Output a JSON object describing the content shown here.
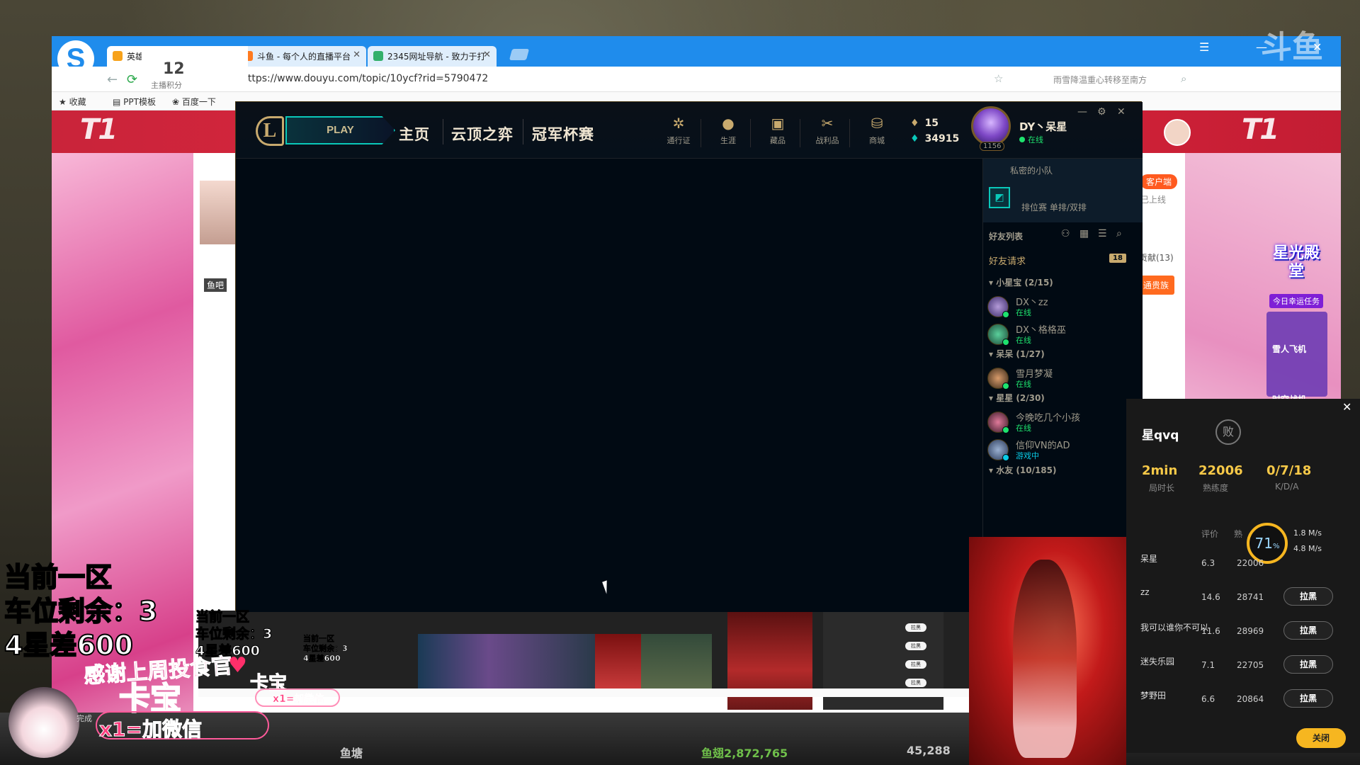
{
  "browser": {
    "tabs": [
      {
        "title": "英雄联盟自动化晋级周榜"
      },
      {
        "title": "斗鱼 - 每个人的直播平台"
      },
      {
        "title": "2345网址导航 - 致力于打"
      }
    ],
    "url": "https://www.douyu.com/topic/10ycf?rid=5790472",
    "search_placeholder": "雨雪降温重心转移至南方",
    "bookmarks": [
      "收藏",
      "PPT模板",
      "百度一下"
    ]
  },
  "page": {
    "score_value": "12",
    "score_label": "主播积分",
    "anchor_label": "鱼吧",
    "client_badge": "客户端",
    "online_text": "已上线",
    "box_count": "贡献(13)",
    "right_button": "通贵族",
    "starlight_title": "星光殿堂",
    "starlight_tag": "今日幸运任务",
    "gifts": [
      "雪人飞机",
      "时空战机"
    ],
    "watermark": "斗鱼"
  },
  "lol": {
    "play_label": "PLAY",
    "nav": [
      "主页",
      "云顶之弈",
      "冠军杯赛"
    ],
    "icon_buttons": [
      {
        "icon": "pass-icon",
        "label": "通行证"
      },
      {
        "icon": "profile-icon",
        "label": "生涯"
      },
      {
        "icon": "collection-icon",
        "label": "藏品"
      },
      {
        "icon": "loot-icon",
        "label": "战利品"
      },
      {
        "icon": "store-icon",
        "label": "商城"
      }
    ],
    "rp": "15",
    "be": "34915",
    "profile": {
      "name": "DY丶呆星",
      "status": "在线",
      "level": "1156"
    },
    "party": {
      "title": "私密的小队",
      "mode": "排位赛 单排/双排"
    },
    "friends_header": "好友列表",
    "friend_requests_label": "好友请求",
    "friend_requests_count": "18",
    "groups": [
      {
        "name": "小星宝 (2/15)",
        "friends": [
          {
            "name": "DX丶zz",
            "status": "在线",
            "ingame": false
          },
          {
            "name": "DX丶格格巫",
            "status": "在线",
            "ingame": false
          }
        ]
      },
      {
        "name": "呆呆 (1/27)",
        "friends": [
          {
            "name": "雪月梦凝",
            "status": "在线",
            "ingame": false
          }
        ]
      },
      {
        "name": "星星 (2/30)",
        "friends": [
          {
            "name": "今晚吃几个小孩",
            "status": "在线",
            "ingame": false
          },
          {
            "name": "信仰VN的AD",
            "status": "游戏中",
            "ingame": true
          }
        ]
      },
      {
        "name": "水友 (10/185)",
        "friends": []
      }
    ]
  },
  "stats": {
    "player": "星qvq",
    "result": "败",
    "duration_value": "2min",
    "duration_label": "局时长",
    "proficiency_value": "22006",
    "proficiency_label": "熟练度",
    "kda_value": "0/7/18",
    "kda_label": "K/D/A",
    "col_rating": "评价",
    "col_prof": "熟",
    "gauge": "71",
    "gauge_unit": "%",
    "net_up": "1.8",
    "net_down": "4.8",
    "net_unit": "M/s",
    "rows": [
      {
        "name": "呆星",
        "rating": "6.3",
        "prof": "22006",
        "button": ""
      },
      {
        "name": "zz",
        "rating": "14.6",
        "prof": "28741",
        "button": "拉黑"
      },
      {
        "name": "我可以谁你不可以",
        "rating": "11.6",
        "prof": "28969",
        "button": "拉黑"
      },
      {
        "name": "迷失乐园",
        "rating": "7.1",
        "prof": "22705",
        "button": "拉黑"
      },
      {
        "name": "梦野田",
        "rating": "6.6",
        "prof": "20864",
        "button": "拉黑"
      }
    ],
    "close_label": "关闭"
  },
  "overlay": {
    "big_lines": [
      "当前一区",
      "车位剩余：3",
      "4星差600"
    ],
    "mid_lines": [
      "当前一区",
      "车位剩余：3",
      "4星差600"
    ],
    "small_lines": [
      "当前一区",
      "车位剩余：3",
      "4星差600"
    ],
    "thanks": "感谢上周投食官",
    "kabao": "卡宝",
    "wechat": "x1=加微信",
    "done": "完成"
  },
  "bottom_bar": {
    "center_text": "鱼塘",
    "coin": "鱼翅2,872,765",
    "fans": "45,288"
  },
  "colors": {
    "lol_gold": "#c8aa6e",
    "lol_teal": "#0ac8b9",
    "online_green": "#1ee36e",
    "douyu_red": "#e2273f",
    "accent_yellow": "#f6b620"
  }
}
